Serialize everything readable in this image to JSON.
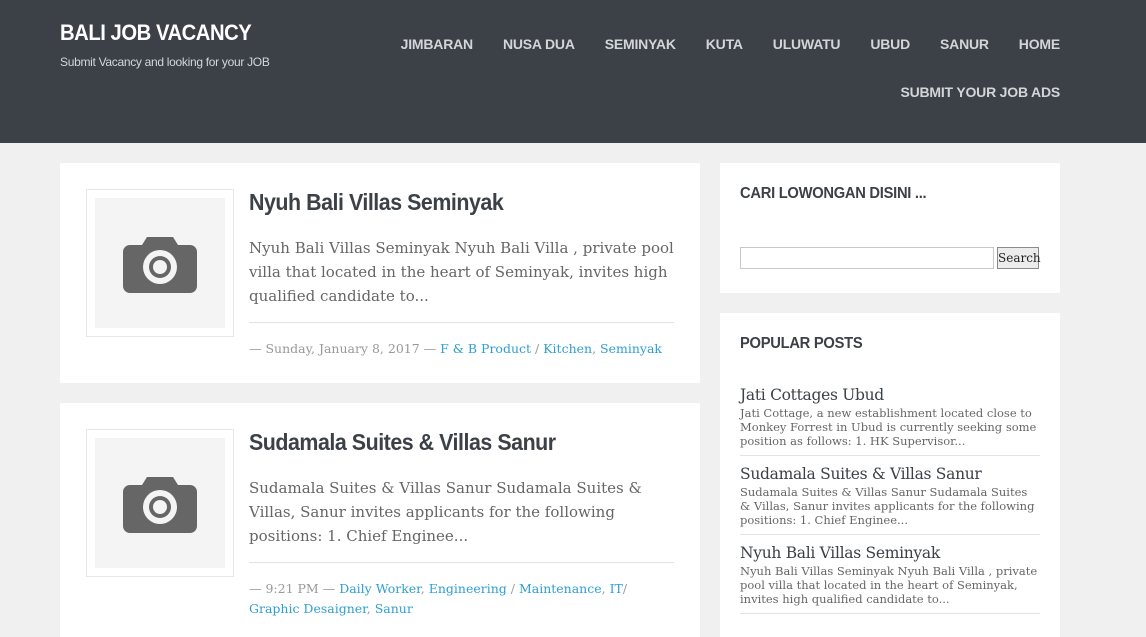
{
  "site": {
    "title": "BALI JOB VACANCY",
    "tagline": "Submit Vacancy and looking for your JOB"
  },
  "nav": {
    "items": [
      "JIMBARAN",
      "NUSA DUA",
      "SEMINYAK",
      "KUTA",
      "ULUWATU",
      "UBUD",
      "SANUR",
      "HOME"
    ],
    "submit": "SUBMIT YOUR JOB ADS"
  },
  "posts": [
    {
      "title": "Nyuh Bali Villas Seminyak",
      "excerpt": "Nyuh Bali Villas Seminyak Nyuh Bali Villa , private pool villa that located in the heart of Seminyak, invites high qualified candidate to...",
      "date": "— Sunday, January 8, 2017 —",
      "categories": [
        "F & B Product",
        "Kitchen",
        "Seminyak"
      ]
    },
    {
      "title": "Sudamala Suites & Villas Sanur",
      "excerpt": "Sudamala Suites & Villas Sanur Sudamala Suites & Villas, Sanur invites applicants for the following positions: 1. Chief Enginee...",
      "date": "— 9:21 PM —",
      "categories": [
        "Daily Worker",
        "Engineering",
        "Maintenance",
        "IT",
        "Graphic Desaigner",
        "Sanur"
      ]
    }
  ],
  "search_widget": {
    "title": "CARI LOWONGAN DISINI ...",
    "button": "Search",
    "placeholder": ""
  },
  "popular": {
    "title": "POPULAR POSTS",
    "items": [
      {
        "title": "Jati Cottages Ubud",
        "excerpt": "Jati Cottage, a new establishment located close to Monkey Forrest in Ubud is currently seeking some position as follows: 1. HK Supervisor..."
      },
      {
        "title": "Sudamala Suites & Villas Sanur",
        "excerpt": "Sudamala Suites & Villas Sanur Sudamala Suites & Villas, Sanur invites applicants for the following positions: 1. Chief Enginee..."
      },
      {
        "title": "Nyuh Bali Villas Seminyak",
        "excerpt": "Nyuh Bali Villas Seminyak Nyuh Bali Villa , private pool villa that located in the heart of Seminyak, invites high qualified candidate to..."
      }
    ]
  },
  "colors": {
    "header_bg": "#3b4147",
    "link": "#2e9fd1",
    "heading": "#3b4147"
  },
  "icons": {
    "thumbnail": "camera-icon"
  }
}
